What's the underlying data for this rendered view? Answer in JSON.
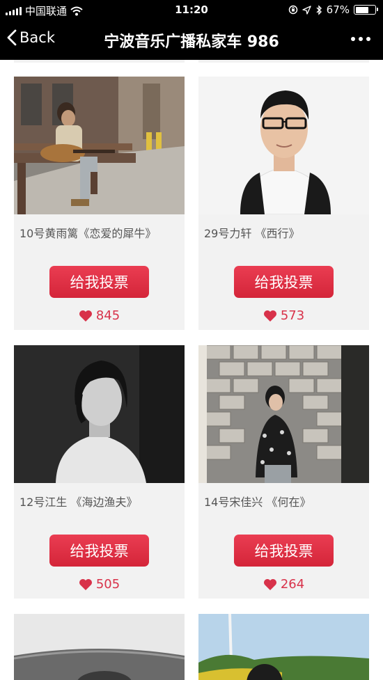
{
  "status_bar": {
    "carrier": "中国联通",
    "time": "11:20",
    "battery_percent": "67%",
    "battery_level": 0.67,
    "icons": [
      "signal-icon",
      "wifi-icon",
      "orientation-lock-icon",
      "location-icon",
      "bluetooth-icon",
      "battery-icon"
    ]
  },
  "nav": {
    "back_label": "Back",
    "title": "宁波音乐广播私家车 986",
    "more_icon": "more-dots-icon"
  },
  "vote_label": "给我投票",
  "contestants": [
    {
      "caption": "10号黄雨篱《恋爱的犀牛》",
      "votes": "845"
    },
    {
      "caption": "29号力轩 《西行》",
      "votes": "573"
    },
    {
      "caption": "12号江生 《海边渔夫》",
      "votes": "505"
    },
    {
      "caption": "14号宋佳兴 《何在》",
      "votes": "264"
    }
  ],
  "colors": {
    "vote_button": "#e03146",
    "vote_count": "#d8324a",
    "card_background": "#f2f2f2",
    "nav_background": "#000000"
  }
}
